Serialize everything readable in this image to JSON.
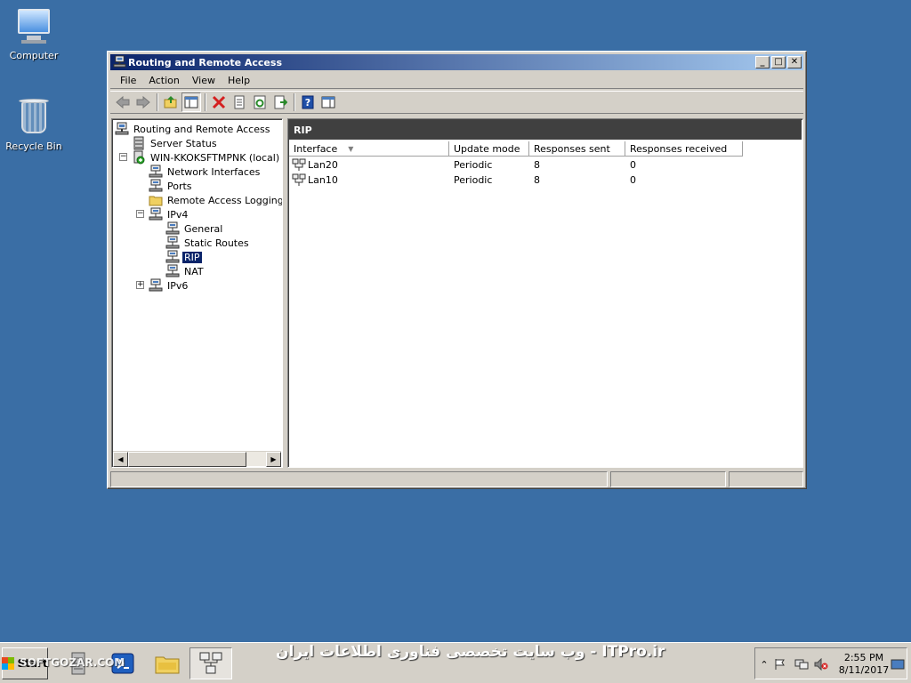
{
  "desktop": {
    "icons": [
      {
        "label": "Computer",
        "icon": "computer-icon"
      },
      {
        "label": "Recycle Bin",
        "icon": "recycle-bin-icon"
      }
    ]
  },
  "window": {
    "title": "Routing and Remote Access",
    "controls": {
      "minimize": "_",
      "maximize": "□",
      "close": "✕"
    },
    "menu": [
      "File",
      "Action",
      "View",
      "Help"
    ],
    "toolbar": [
      "back-icon",
      "forward-icon",
      "up-folder-icon",
      "show-hide-tree-icon",
      "delete-icon",
      "properties-icon",
      "refresh-icon",
      "export-list-icon",
      "help-icon",
      "show-hide-action-pane-icon"
    ],
    "tree": [
      {
        "label": "Routing and Remote Access",
        "icon": "server-icon"
      },
      {
        "label": "Server Status",
        "icon": "server-status-icon"
      },
      {
        "label": "WIN-KKOKSFTMPNK (local)",
        "icon": "local-server-icon",
        "expander": "−"
      },
      {
        "label": "Network Interfaces",
        "icon": "network-icon"
      },
      {
        "label": "Ports",
        "icon": "network-icon"
      },
      {
        "label": "Remote Access Logging & P",
        "icon": "folder-icon"
      },
      {
        "label": "IPv4",
        "icon": "network-icon",
        "expander": "−"
      },
      {
        "label": "General",
        "icon": "network-icon"
      },
      {
        "label": "Static Routes",
        "icon": "network-icon"
      },
      {
        "label": "RIP",
        "icon": "network-icon",
        "selected": true
      },
      {
        "label": "NAT",
        "icon": "network-icon"
      },
      {
        "label": "IPv6",
        "icon": "network-icon",
        "expander": "+"
      }
    ],
    "detail": {
      "title": "RIP",
      "columns": [
        "Interface",
        "Update mode",
        "Responses sent",
        "Responses received"
      ],
      "rows": [
        {
          "interface": "Lan20",
          "update_mode": "Periodic",
          "responses_sent": "8",
          "responses_received": "0"
        },
        {
          "interface": "Lan10",
          "update_mode": "Periodic",
          "responses_sent": "8",
          "responses_received": "0"
        }
      ]
    }
  },
  "taskbar": {
    "start_label": "Start",
    "watermark_left": "SOFTGOZAR.COM",
    "watermark_right": "وب سایت تخصصی فناوری اطلاعات ایران - ITPro.ir",
    "clock_time": "2:55 PM",
    "clock_date": "8/11/2017",
    "tray_expand": "⌃"
  },
  "colors": {
    "desktop": "#3a6ea5",
    "titlebar_start": "#0a246a",
    "titlebar_end": "#a6caf0",
    "selection": "#0a246a",
    "detail_header": "#404040",
    "chrome": "#d4d0c8"
  }
}
